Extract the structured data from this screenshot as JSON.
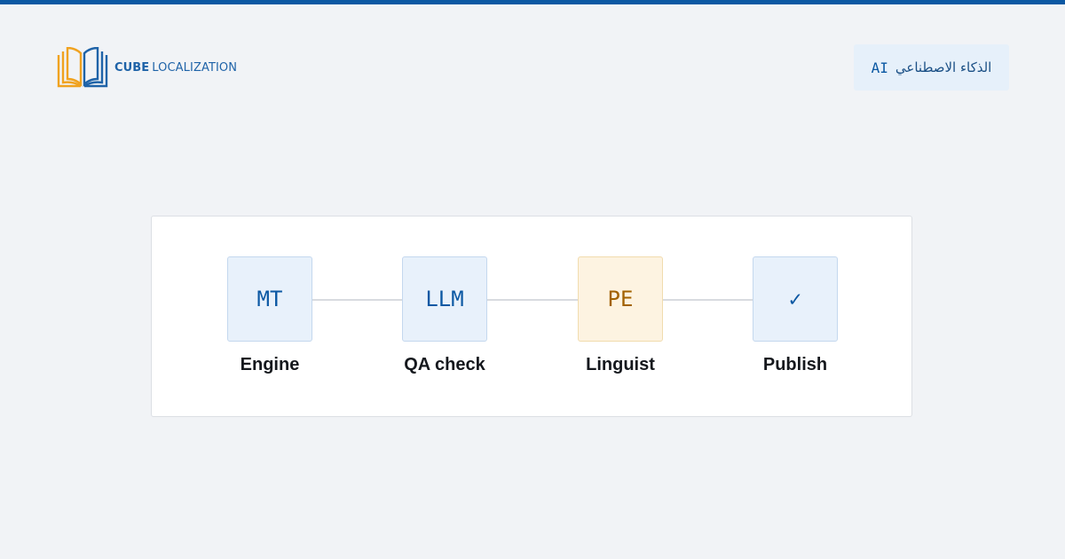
{
  "brand": {
    "name_strong": "CUBE",
    "name_light": "LOCALIZATION",
    "icon": "open-book-logo-icon",
    "colors": {
      "orange": "#f0a21f",
      "blue": "#1f63a8"
    }
  },
  "language": {
    "code": "AI",
    "name": "الذكاء الاصطناعي"
  },
  "accent_color": "#0b58a3",
  "pipeline": {
    "steps": [
      {
        "code": "MT",
        "label": "Engine",
        "variant": "blue"
      },
      {
        "code": "LLM",
        "label": "QA check",
        "variant": "blue"
      },
      {
        "code": "PE",
        "label": "Linguist",
        "variant": "amber"
      },
      {
        "code": "✓",
        "label": "Publish",
        "variant": "blue",
        "icon": "checkmark-icon"
      }
    ]
  }
}
